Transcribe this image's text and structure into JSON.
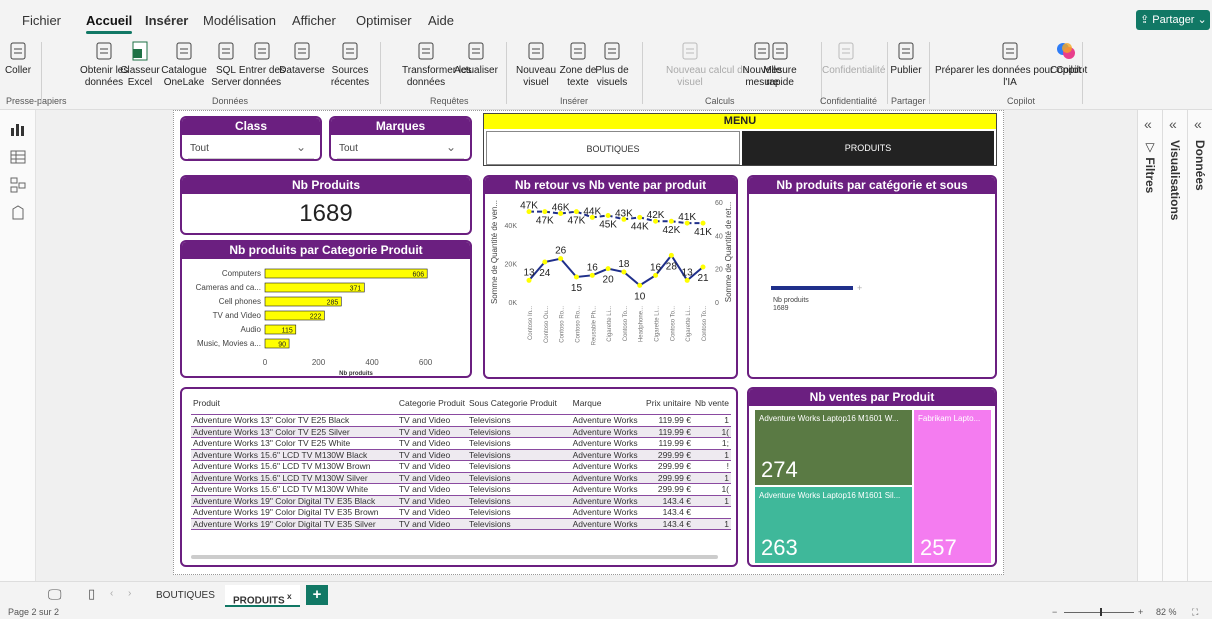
{
  "menu_tabs": [
    "Fichier",
    "Accueil",
    "Insérer",
    "Modélisation",
    "Afficher",
    "Optimiser",
    "Aide"
  ],
  "share_label": "Partager",
  "ribbon": {
    "groups": [
      {
        "label": "Presse-papiers",
        "buttons": [
          {
            "label": "Coller",
            "icon": "paste-icon"
          }
        ]
      },
      {
        "label": "Données",
        "buttons": [
          {
            "label": "Obtenir les\ndonnées",
            "icon": "database-icon"
          },
          {
            "label": "Classeur\nExcel",
            "icon": "excel-icon"
          },
          {
            "label": "Catalogue\nOneLake",
            "icon": "onelake-icon"
          },
          {
            "label": "SQL\nServer",
            "icon": "sql-server-icon"
          },
          {
            "label": "Entrer des\ndonnées",
            "icon": "table-icon"
          },
          {
            "label": "Dataverse",
            "icon": "dataverse-icon"
          },
          {
            "label": "Sources\nrécentes",
            "icon": "recent-sources-icon"
          }
        ]
      },
      {
        "label": "Requêtes",
        "buttons": [
          {
            "label": "Transformer les\ndonnées",
            "icon": "transform-icon"
          },
          {
            "label": "Actualiser",
            "icon": "refresh-icon"
          }
        ]
      },
      {
        "label": "Insérer",
        "buttons": [
          {
            "label": "Nouveau\nvisuel",
            "icon": "new-visual-icon"
          },
          {
            "label": "Zone de\ntexte",
            "icon": "textbox-icon"
          },
          {
            "label": "Plus de\nvisuels",
            "icon": "more-visuals-icon"
          }
        ]
      },
      {
        "label": "Calculs",
        "buttons": [
          {
            "label": "Nouveau calcul de\nvisuel",
            "icon": "visual-calc-icon",
            "disabled": true
          },
          {
            "label": "Nouvelle\nmesure",
            "icon": "calculator-icon"
          },
          {
            "label": "Mesure\nrapide",
            "icon": "quick-measure-icon"
          }
        ]
      },
      {
        "label": "Confidentialité",
        "buttons": [
          {
            "label": "Confidentialité",
            "icon": "sensitivity-icon",
            "disabled": true
          }
        ]
      },
      {
        "label": "Partager",
        "buttons": [
          {
            "label": "Publier",
            "icon": "publish-icon"
          }
        ]
      },
      {
        "label": "Copilot",
        "buttons": [
          {
            "label": "Préparer les données pour Copilot\nl'IA",
            "icon": "prepare-data-icon"
          },
          {
            "label": "Copilot",
            "icon": "copilot-icon"
          }
        ]
      }
    ]
  },
  "slicers": [
    {
      "title": "Class",
      "value": "Tout"
    },
    {
      "title": "Marques",
      "value": "Tout"
    }
  ],
  "menu": {
    "title": "MENU",
    "buttons": [
      "BOUTIQUES",
      "PRODUITS"
    ]
  },
  "kpi": {
    "title": "Nb Produits",
    "value": "1689"
  },
  "bar_visual": {
    "title": "Nb produits par Categorie Produit"
  },
  "line_visual": {
    "title": "Nb retour vs Nb vente par produit"
  },
  "cat_visual": {
    "title": "Nb produits par catégorie et sous catégorie"
  },
  "table": {
    "columns": [
      "Produit",
      "Categorie Produit",
      "Sous Categorie Produit",
      "Marque",
      "Prix unitaire",
      "Nb vente"
    ],
    "rows": [
      [
        "Adventure Works 13\" Color TV E25 Black",
        "TV and Video",
        "Televisions",
        "Adventure Works",
        "119.99 €",
        "1"
      ],
      [
        "Adventure Works 13\" Color TV E25 Silver",
        "TV and Video",
        "Televisions",
        "Adventure Works",
        "119.99 €",
        "1("
      ],
      [
        "Adventure Works 13\" Color TV E25 White",
        "TV and Video",
        "Televisions",
        "Adventure Works",
        "119.99 €",
        "1;"
      ],
      [
        "Adventure Works 15.6\" LCD TV M130W Black",
        "TV and Video",
        "Televisions",
        "Adventure Works",
        "299.99 €",
        "1"
      ],
      [
        "Adventure Works 15.6\" LCD TV M130W Brown",
        "TV and Video",
        "Televisions",
        "Adventure Works",
        "299.99 €",
        "!"
      ],
      [
        "Adventure Works 15.6\" LCD TV M130W Silver",
        "TV and Video",
        "Televisions",
        "Adventure Works",
        "299.99 €",
        "1"
      ],
      [
        "Adventure Works 15.6\" LCD TV M130W White",
        "TV and Video",
        "Televisions",
        "Adventure Works",
        "299.99 €",
        "1("
      ],
      [
        "Adventure Works 19\" Color Digital TV E35 Black",
        "TV and Video",
        "Televisions",
        "Adventure Works",
        "143.4 €",
        "1"
      ],
      [
        "Adventure Works 19\" Color Digital TV E35 Brown",
        "TV and Video",
        "Televisions",
        "Adventure Works",
        "143.4 €",
        ""
      ],
      [
        "Adventure Works 19\" Color Digital TV E35 Silver",
        "TV and Video",
        "Televisions",
        "Adventure Works",
        "143.4 €",
        "1"
      ]
    ]
  },
  "treemap": {
    "title": "Nb ventes par Produit",
    "cells": [
      {
        "label": "Adventure Works Laptop16 M1601 W...",
        "value": "274",
        "color": "#5a7a44"
      },
      {
        "label": "Adventure Works Laptop16 M1601 Sil...",
        "value": "263",
        "color": "#3fb89a"
      },
      {
        "label": "Fabrikam Lapto...",
        "value": "257",
        "color": "#f47cf0"
      }
    ]
  },
  "right_panes": [
    "Données",
    "Visualisations",
    "Filtres"
  ],
  "page_tabs": [
    "BOUTIQUES",
    "PRODUITS"
  ],
  "status": {
    "page": "Page 2 sur 2",
    "zoom": "82 %"
  },
  "colors": {
    "accent": "#117865",
    "visual_header": "#6b1f80",
    "bar": "#ffff00",
    "line": "#1f2f8a",
    "marker": "#ffff00",
    "menu_yellow": "#ffff00"
  },
  "chart_data": [
    {
      "type": "bar",
      "title": "Nb produits par Categorie Produit",
      "categories": [
        "Computers",
        "Cameras and ca...",
        "Cell phones",
        "TV and Video",
        "Audio",
        "Music, Movies a..."
      ],
      "values": [
        606,
        371,
        285,
        222,
        115,
        90
      ],
      "xlabel": "Nb produits",
      "xticks": [
        "0",
        "200",
        "400",
        "600"
      ],
      "xlim": [
        0,
        680
      ]
    },
    {
      "type": "line",
      "title": "Nb retour vs Nb vente par produit",
      "categories": [
        "Contoso In...",
        "Contoso Ou...",
        "Contoso Ro...",
        "Contoso Ro...",
        "Reusable Ph...",
        "Cigarette Li...",
        "Contoso To...",
        "Headphone...",
        "Cigarette Li...",
        "Contoso To...",
        "Cigarette Li...",
        "Contoso To..."
      ],
      "ylabel_left": "Somme de Quantité de ven...",
      "ylabel_right": "Somme de Quantité de ret...",
      "yticks_left": [
        "0K",
        "20K",
        "40K"
      ],
      "yticks_right": [
        "0",
        "20",
        "40",
        "60"
      ],
      "series": [
        {
          "name": "Somme de Quantité de ven...",
          "axis": "left",
          "values": [
            47,
            47,
            46,
            47,
            44,
            45,
            43,
            44,
            42,
            42,
            41,
            41
          ],
          "labels": [
            "47K",
            "47K",
            "46K",
            "47K",
            "44K",
            "45K",
            "43K",
            "44K",
            "42K",
            "42K",
            "41K",
            "41K"
          ]
        },
        {
          "name": "Somme de Quantité de ret...",
          "axis": "right",
          "values": [
            13,
            24,
            26,
            15,
            16,
            20,
            18,
            10,
            16,
            28,
            13,
            21
          ],
          "labels": [
            "13",
            "24",
            "26",
            "15",
            "16",
            "20",
            "18",
            "10",
            "16",
            "28",
            "13",
            "21"
          ]
        }
      ]
    },
    {
      "type": "bar",
      "title": "Nb produits par catégorie et sous catégorie",
      "categories": [
        "Nb produits"
      ],
      "values": [
        1689
      ]
    }
  ]
}
